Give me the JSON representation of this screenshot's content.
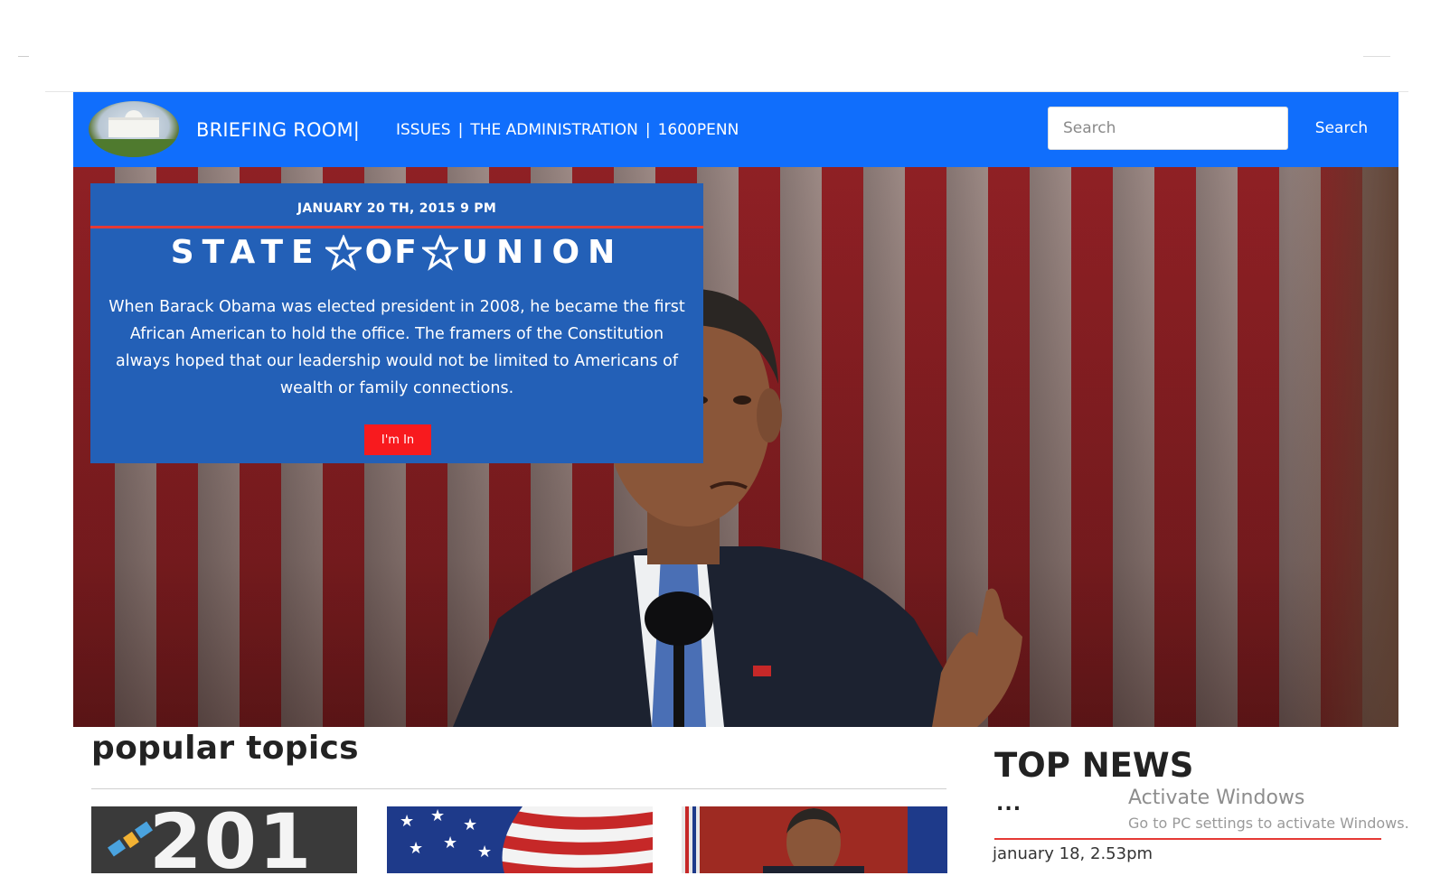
{
  "nav": {
    "brand": "BRIEFING ROOM|",
    "links": [
      "ISSUES",
      "|",
      "THE ADMINISTRATION",
      "|",
      "1600PENN"
    ],
    "search_placeholder": "Search",
    "search_button": "Search"
  },
  "hero": {
    "date": "JANUARY 20 TH, 2015 9 PM",
    "title_words": [
      "STATE",
      "OF",
      "UNION"
    ],
    "body": "When Barack Obama was elected president in 2008, he became the first African American to hold the office. The framers of the Constitution always hoped that our leadership would not be limited to Americans of wealth or family connections.",
    "cta": "I'm In"
  },
  "popular": {
    "title": "popular topics",
    "thumb1_text": "201"
  },
  "top_news": {
    "title": "TOP NEWS",
    "dots": "...",
    "date": "january 18, 2.53pm"
  },
  "watermark": {
    "title": "Activate Windows",
    "subtitle": "Go to PC settings to activate Windows."
  },
  "colors": {
    "nav_bg": "#106efc",
    "card_bg": "#2360b7",
    "accent_red": "#f81a1e"
  }
}
